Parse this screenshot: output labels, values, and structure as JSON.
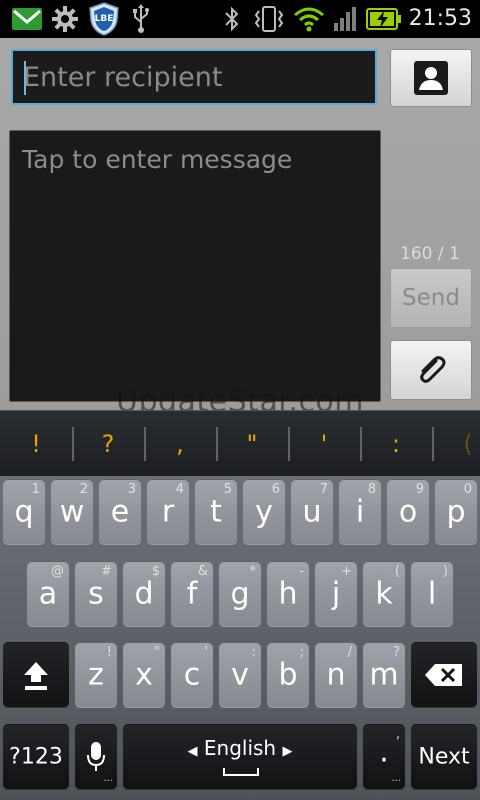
{
  "status_bar": {
    "icons": [
      "gmail-icon",
      "settings-icon",
      "lbe-shield-icon",
      "usb-icon",
      "bluetooth-icon",
      "vibrate-icon",
      "wifi-icon",
      "signal-icon",
      "battery-charging-icon"
    ],
    "lbe_label": "LBE",
    "time": "21:53"
  },
  "compose": {
    "recipient_placeholder": "Enter recipient",
    "message_placeholder": "Tap to enter message",
    "counter": "160 / 1",
    "send_label": "Send",
    "watermark": "UpdateStar.com"
  },
  "suggestions": [
    "!",
    "?",
    ",",
    "\"",
    "'",
    ":",
    "("
  ],
  "keyboard": {
    "row1": [
      {
        "key": "q",
        "hint": "1"
      },
      {
        "key": "w",
        "hint": "2"
      },
      {
        "key": "e",
        "hint": "3"
      },
      {
        "key": "r",
        "hint": "4"
      },
      {
        "key": "t",
        "hint": "5"
      },
      {
        "key": "y",
        "hint": "6"
      },
      {
        "key": "u",
        "hint": "7"
      },
      {
        "key": "i",
        "hint": "8"
      },
      {
        "key": "o",
        "hint": "9"
      },
      {
        "key": "p",
        "hint": "0"
      }
    ],
    "row2": [
      {
        "key": "a",
        "hint": "@"
      },
      {
        "key": "s",
        "hint": "#"
      },
      {
        "key": "d",
        "hint": "$"
      },
      {
        "key": "f",
        "hint": "&"
      },
      {
        "key": "g",
        "hint": "*"
      },
      {
        "key": "h",
        "hint": "-"
      },
      {
        "key": "j",
        "hint": "+"
      },
      {
        "key": "k",
        "hint": "("
      },
      {
        "key": "l",
        "hint": ")"
      }
    ],
    "row3": [
      {
        "key": "z",
        "hint": "!"
      },
      {
        "key": "x",
        "hint": "\""
      },
      {
        "key": "c",
        "hint": "'"
      },
      {
        "key": "v",
        "hint": ":"
      },
      {
        "key": "b",
        "hint": ";"
      },
      {
        "key": "n",
        "hint": "/"
      },
      {
        "key": "m",
        "hint": "?"
      }
    ],
    "symbols_label": "?123",
    "language_label": "English",
    "period_label": ".",
    "period_hint": ",",
    "next_label": "Next"
  },
  "colors": {
    "accent": "#59a9d9",
    "suggestion": "#e8a400",
    "wifi": "#7fd000",
    "battery": "#9bd000"
  }
}
